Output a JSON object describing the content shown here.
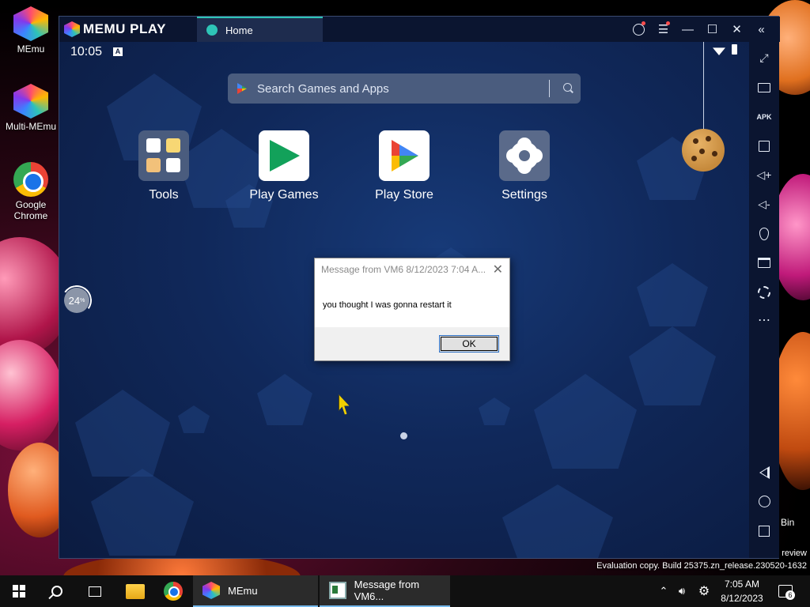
{
  "desktop": {
    "icons": [
      {
        "label": "MEmu"
      },
      {
        "label": "Multi-MEmu"
      },
      {
        "label": "Google Chrome"
      }
    ],
    "recycle_bin_label": "Bin",
    "watermark_line1": "review",
    "watermark_line2": "Evaluation copy. Build 25375.zn_release.230520-1632"
  },
  "emulator": {
    "brand": "MEMU PLAY",
    "tab_label": "Home",
    "status": {
      "time": "10:05",
      "notification_glyph": "A"
    },
    "search": {
      "placeholder": "Search Games and Apps"
    },
    "apps": [
      {
        "label": "Tools"
      },
      {
        "label": "Play Games"
      },
      {
        "label": "Play Store"
      },
      {
        "label": "Settings"
      }
    ],
    "progress": {
      "value": "24",
      "unit": "%"
    },
    "sidebar_buttons": [
      "fullscreen-icon",
      "keyboard-icon",
      "apk-icon",
      "multi-instance-icon",
      "volume-up-icon",
      "volume-down-icon",
      "location-icon",
      "folder-icon",
      "settings-icon",
      "more-icon",
      "back-icon",
      "home-icon",
      "recents-icon"
    ],
    "sidebar_apk_label": "APK"
  },
  "dialog": {
    "title": "Message from VM6 8/12/2023 7:04 A...",
    "message": "you thought I was gonna restart it",
    "ok_label": "OK"
  },
  "taskbar": {
    "apps": [
      {
        "label": "MEmu"
      },
      {
        "label": "Message from VM6..."
      }
    ],
    "time": "7:05 AM",
    "date": "8/12/2023",
    "notification_count": "6"
  }
}
